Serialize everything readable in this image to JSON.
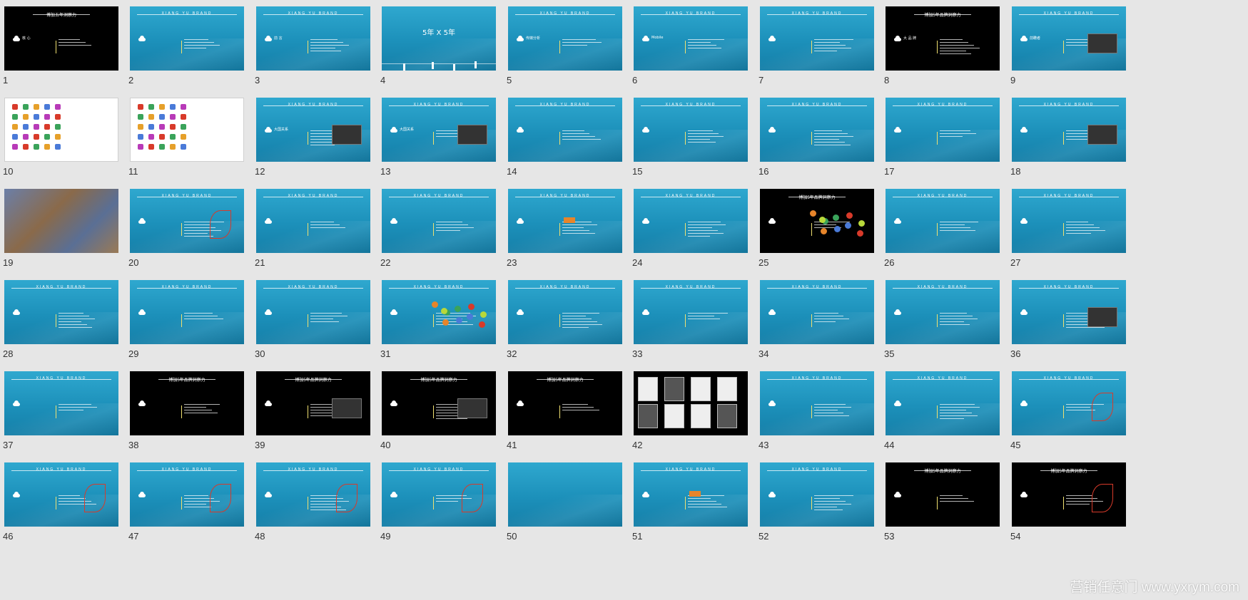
{
  "header_text": "XIANG   YU   BRAND",
  "black_header_text": "博加5年品牌洞察力",
  "slides": [
    {
      "num": "1",
      "theme": "black",
      "title": "核 心",
      "header": "博加五年洞察力"
    },
    {
      "num": "2",
      "theme": "blue",
      "title": "",
      "header": "XIANG   YU   BRAND"
    },
    {
      "num": "3",
      "theme": "blue",
      "title": "前 言",
      "header": "XIANG   YU   BRAND"
    },
    {
      "num": "4",
      "theme": "blue",
      "title": "5年 X 5年",
      "header": ""
    },
    {
      "num": "5",
      "theme": "blue",
      "title": "传媒分析",
      "header": "XIANG   YU   BRAND"
    },
    {
      "num": "6",
      "theme": "blue",
      "title": "Mobile",
      "header": "XIANG   YU   BRAND"
    },
    {
      "num": "7",
      "theme": "blue",
      "title": "",
      "header": "XIANG   YU   BRAND"
    },
    {
      "num": "8",
      "theme": "black",
      "title": "大 品 牌",
      "header": "博加5年品牌洞察力"
    },
    {
      "num": "9",
      "theme": "blue",
      "title": "前瞻者",
      "header": "XIANG   YU   BRAND"
    },
    {
      "num": "10",
      "theme": "white",
      "title": "",
      "header": ""
    },
    {
      "num": "11",
      "theme": "white",
      "title": "",
      "header": ""
    },
    {
      "num": "12",
      "theme": "blue",
      "title": "大国关系",
      "header": "XIANG   YU   BRAND"
    },
    {
      "num": "13",
      "theme": "blue",
      "title": "大国关系",
      "header": "XIANG   YU   BRAND"
    },
    {
      "num": "14",
      "theme": "blue",
      "title": "",
      "header": "XIANG   YU   BRAND"
    },
    {
      "num": "15",
      "theme": "blue",
      "title": "",
      "header": "XIANG   YU   BRAND"
    },
    {
      "num": "16",
      "theme": "blue",
      "title": "",
      "header": "XIANG   YU   BRAND"
    },
    {
      "num": "17",
      "theme": "blue",
      "title": "",
      "header": "XIANG   YU   BRAND"
    },
    {
      "num": "18",
      "theme": "blue",
      "title": "",
      "header": "XIANG   YU   BRAND"
    },
    {
      "num": "19",
      "theme": "map",
      "title": "",
      "header": ""
    },
    {
      "num": "20",
      "theme": "blue",
      "title": "",
      "header": "XIANG   YU   BRAND"
    },
    {
      "num": "21",
      "theme": "blue",
      "title": "",
      "header": "XIANG   YU   BRAND"
    },
    {
      "num": "22",
      "theme": "blue",
      "title": "",
      "header": "XIANG   YU   BRAND"
    },
    {
      "num": "23",
      "theme": "blue",
      "title": "",
      "header": "XIANG   YU   BRAND"
    },
    {
      "num": "24",
      "theme": "blue",
      "title": "",
      "header": "XIANG   YU   BRAND"
    },
    {
      "num": "25",
      "theme": "black",
      "title": "",
      "header": "博加5年品牌洞察力"
    },
    {
      "num": "26",
      "theme": "blue",
      "title": "",
      "header": "XIANG   YU   BRAND"
    },
    {
      "num": "27",
      "theme": "blue",
      "title": "",
      "header": "XIANG   YU   BRAND"
    },
    {
      "num": "28",
      "theme": "blue",
      "title": "",
      "header": "XIANG   YU   BRAND"
    },
    {
      "num": "29",
      "theme": "blue",
      "title": "",
      "header": "XIANG   YU   BRAND"
    },
    {
      "num": "30",
      "theme": "blue",
      "title": "",
      "header": "XIANG   YU   BRAND"
    },
    {
      "num": "31",
      "theme": "blue",
      "title": "",
      "header": "XIANG   YU   BRAND"
    },
    {
      "num": "32",
      "theme": "blue",
      "title": "",
      "header": "XIANG   YU   BRAND"
    },
    {
      "num": "33",
      "theme": "blue",
      "title": "",
      "header": "XIANG   YU   BRAND"
    },
    {
      "num": "34",
      "theme": "blue",
      "title": "",
      "header": "XIANG   YU   BRAND"
    },
    {
      "num": "35",
      "theme": "blue",
      "title": "",
      "header": "XIANG   YU   BRAND"
    },
    {
      "num": "36",
      "theme": "blue",
      "title": "",
      "header": "XIANG   YU   BRAND"
    },
    {
      "num": "37",
      "theme": "blue",
      "title": "",
      "header": "XIANG   YU   BRAND"
    },
    {
      "num": "38",
      "theme": "black",
      "title": "",
      "header": "博加5年品牌洞察力"
    },
    {
      "num": "39",
      "theme": "black",
      "title": "",
      "header": "博加5年品牌洞察力"
    },
    {
      "num": "40",
      "theme": "black",
      "title": "",
      "header": "博加5年品牌洞察力"
    },
    {
      "num": "41",
      "theme": "black",
      "title": "",
      "header": "博加5年品牌洞察力"
    },
    {
      "num": "42",
      "theme": "black",
      "title": "",
      "header": ""
    },
    {
      "num": "43",
      "theme": "blue",
      "title": "",
      "header": "XIANG   YU   BRAND"
    },
    {
      "num": "44",
      "theme": "blue",
      "title": "",
      "header": "XIANG   YU   BRAND"
    },
    {
      "num": "45",
      "theme": "blue",
      "title": "",
      "header": "XIANG   YU   BRAND"
    },
    {
      "num": "46",
      "theme": "blue",
      "title": "",
      "header": "XIANG   YU   BRAND"
    },
    {
      "num": "47",
      "theme": "blue",
      "title": "",
      "header": "XIANG   YU   BRAND"
    },
    {
      "num": "48",
      "theme": "blue",
      "title": "",
      "header": "XIANG   YU   BRAND"
    },
    {
      "num": "49",
      "theme": "blue",
      "title": "",
      "header": "XIANG   YU   BRAND"
    },
    {
      "num": "50",
      "theme": "blue",
      "title": "",
      "header": ""
    },
    {
      "num": "51",
      "theme": "blue",
      "title": "",
      "header": "XIANG   YU   BRAND"
    },
    {
      "num": "52",
      "theme": "blue",
      "title": "",
      "header": "XIANG   YU   BRAND"
    },
    {
      "num": "53",
      "theme": "black",
      "title": "",
      "header": "博加5年品牌洞察力"
    },
    {
      "num": "54",
      "theme": "black",
      "title": "",
      "header": "博加5年品牌洞察力"
    }
  ],
  "watermark": "营销任意门  www.yxrym.com",
  "colors": {
    "page_bg": "#e6e6e6",
    "slide_blue": "#1c90ba",
    "slide_black": "#000000",
    "number_text": "#333333"
  }
}
